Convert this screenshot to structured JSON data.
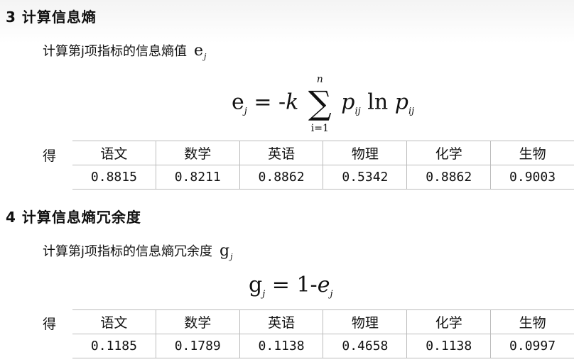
{
  "section3": {
    "heading": "3 计算信息熵",
    "desc": "计算第j项指标的信息熵值",
    "desc_symbol": "e",
    "desc_sub": "j",
    "formula": {
      "lhs": "e",
      "lhs_sub": "j",
      "eq": "= -",
      "k": "k",
      "sum_top": "n",
      "sum_bottom": "i=1",
      "p1": "p",
      "p1_sub": "ij",
      "ln": "ln",
      "p2": "p",
      "p2_sub": "ij"
    },
    "de": "得",
    "headers": [
      "语文",
      "数学",
      "英语",
      "物理",
      "化学",
      "生物"
    ],
    "values": [
      "0.8815",
      "0.8211",
      "0.8862",
      "0.5342",
      "0.8862",
      "0.9003"
    ]
  },
  "section4": {
    "heading": "4 计算信息熵冗余度",
    "desc": "计算第j项指标的信息熵冗余度",
    "desc_symbol": "g",
    "desc_sub": "j",
    "formula": {
      "lhs": "g",
      "lhs_sub": "j",
      "eq": "= 1-",
      "e": "e",
      "e_sub": "j"
    },
    "de": "得",
    "headers": [
      "语文",
      "数学",
      "英语",
      "物理",
      "化学",
      "生物"
    ],
    "values": [
      "0.1185",
      "0.1789",
      "0.1138",
      "0.4658",
      "0.1138",
      "0.0997"
    ]
  }
}
